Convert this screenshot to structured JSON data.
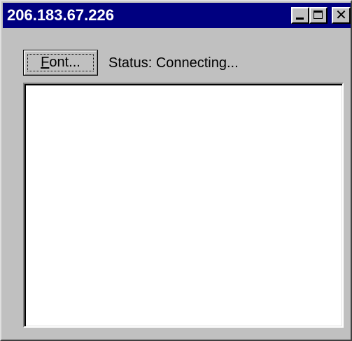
{
  "window": {
    "title": "206.183.67.226",
    "controls": {
      "minimize_icon": "minimize-icon",
      "maximize_icon": "maximize-icon",
      "close_icon": "close-icon",
      "close_glyph": "✕"
    }
  },
  "toolbar": {
    "font_button": {
      "label_first": "F",
      "label_rest": "ont..."
    },
    "status_text": "Status: Connecting..."
  },
  "output": {
    "content": ""
  },
  "colors": {
    "titlebar": "#000080",
    "face": "#c0c0c0",
    "text_area": "#ffffff"
  }
}
